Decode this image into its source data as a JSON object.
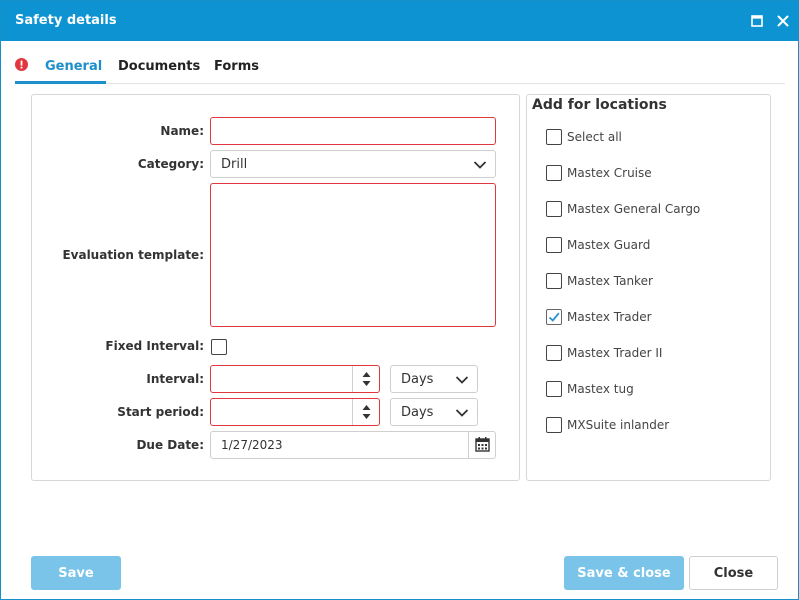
{
  "window": {
    "title": "Safety details"
  },
  "tabs": [
    {
      "label": "General",
      "active": true,
      "has_error": true
    },
    {
      "label": "Documents",
      "active": false
    },
    {
      "label": "Forms",
      "active": false
    }
  ],
  "form": {
    "name": {
      "label": "Name:",
      "value": ""
    },
    "category": {
      "label": "Category:",
      "value": "Drill"
    },
    "evaluation_template": {
      "label": "Evaluation template:",
      "value": ""
    },
    "fixed_interval": {
      "label": "Fixed Interval:",
      "checked": false
    },
    "interval": {
      "label": "Interval:",
      "value": "",
      "unit": "Days"
    },
    "start_period": {
      "label": "Start period:",
      "value": "",
      "unit": "Days"
    },
    "due_date": {
      "label": "Due Date:",
      "value": "1/27/2023"
    }
  },
  "locations": {
    "title": "Add for locations",
    "items": [
      {
        "label": "Select all",
        "checked": false
      },
      {
        "label": "Mastex Cruise",
        "checked": false
      },
      {
        "label": "Mastex General Cargo",
        "checked": false
      },
      {
        "label": "Mastex Guard",
        "checked": false
      },
      {
        "label": "Mastex Tanker",
        "checked": false
      },
      {
        "label": "Mastex Trader",
        "checked": true
      },
      {
        "label": "Mastex Trader II",
        "checked": false
      },
      {
        "label": "Mastex tug",
        "checked": false
      },
      {
        "label": "MXSuite inlander",
        "checked": false
      }
    ]
  },
  "footer": {
    "save_label": "Save",
    "save_close_label": "Save & close",
    "close_label": "Close"
  },
  "colors": {
    "titlebar": "#0d93d2",
    "accent": "#1d8fcb",
    "error": "#e0383e",
    "primary_button": "#79c4e8"
  }
}
